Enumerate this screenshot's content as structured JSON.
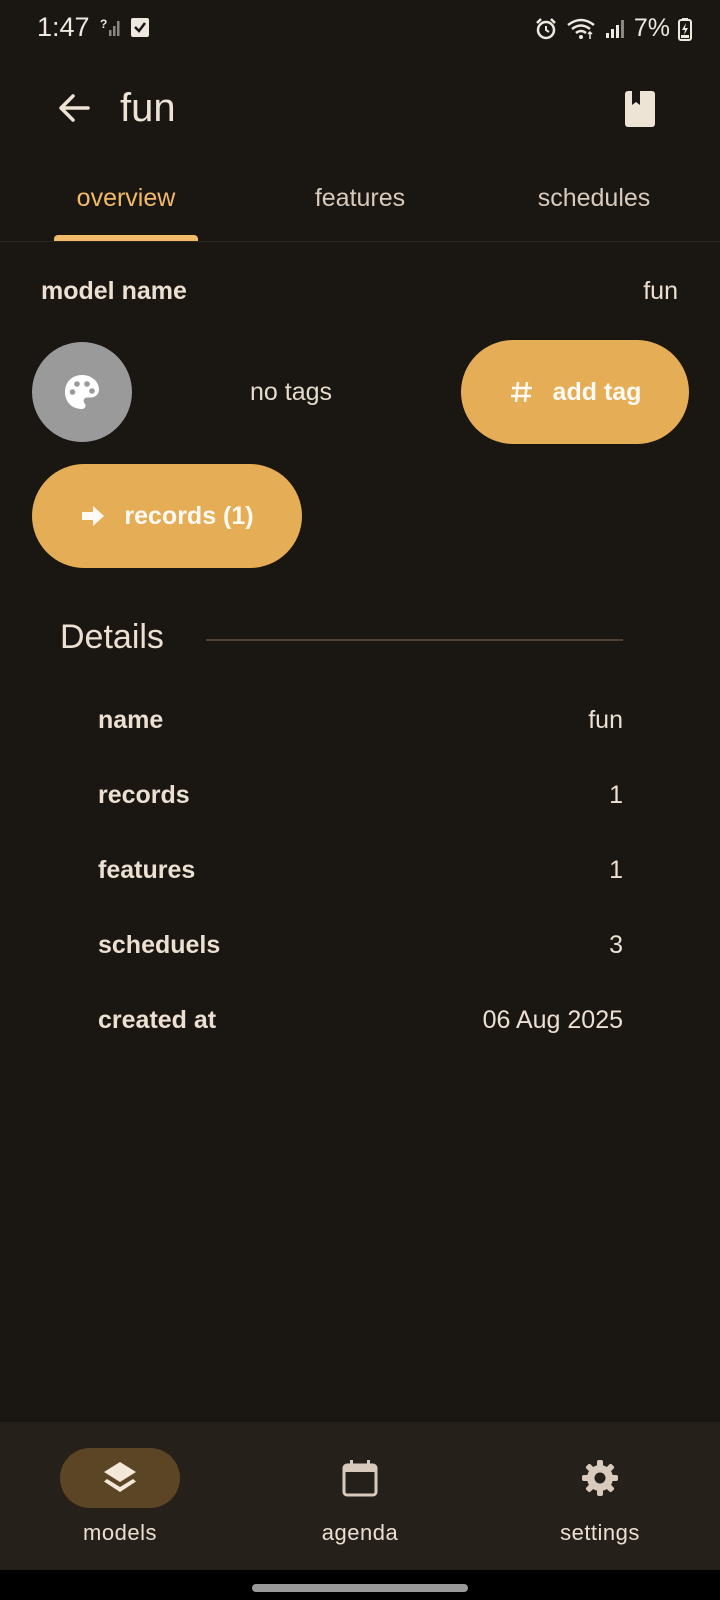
{
  "status_bar": {
    "time": "1:47",
    "battery": "7%"
  },
  "app_bar": {
    "title": "fun",
    "back_icon": "arrow-back-icon",
    "action_icon": "book-icon"
  },
  "tabs": [
    {
      "label": "overview",
      "active": true
    },
    {
      "label": "features",
      "active": false
    },
    {
      "label": "schedules",
      "active": false
    }
  ],
  "model": {
    "name_label": "model name",
    "name_value": "fun"
  },
  "tags": {
    "empty_text": "no tags",
    "add_tag_label": "add tag",
    "palette_icon": "palette-icon",
    "hash_icon": "hash-icon"
  },
  "records_button": {
    "label": "records (1)",
    "icon": "arrow-right-icon"
  },
  "details": {
    "title": "Details",
    "rows": [
      {
        "label": "name",
        "value": "fun"
      },
      {
        "label": "records",
        "value": "1"
      },
      {
        "label": "features",
        "value": "1"
      },
      {
        "label": "scheduels",
        "value": "3"
      },
      {
        "label": "created at",
        "value": "06 Aug 2025"
      }
    ]
  },
  "bottom_nav": [
    {
      "label": "models",
      "icon": "layers-icon",
      "active": true
    },
    {
      "label": "agenda",
      "icon": "calendar-icon",
      "active": false
    },
    {
      "label": "settings",
      "icon": "gear-icon",
      "active": false
    }
  ],
  "colors": {
    "background": "#1a1611",
    "accent": "#e6ad57",
    "active_tab": "#f2bb6a",
    "text": "#ece0d2"
  }
}
